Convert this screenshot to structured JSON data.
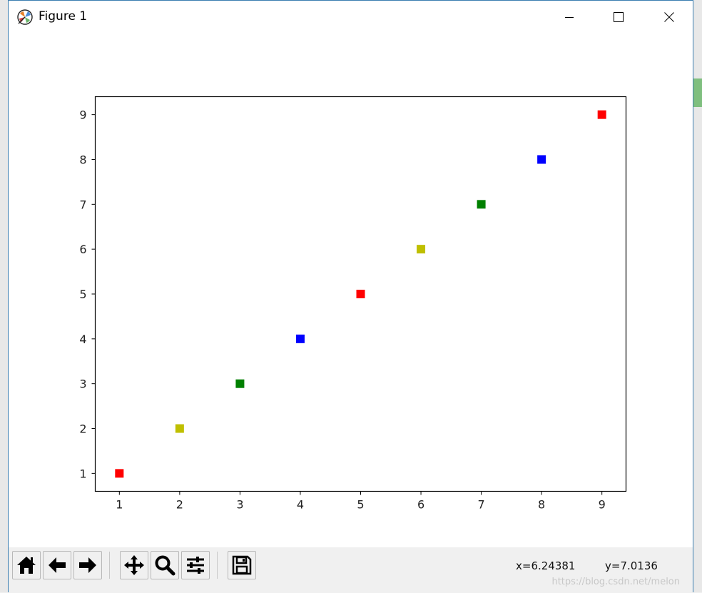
{
  "window": {
    "title": "Figure 1"
  },
  "chart_data": {
    "type": "scatter",
    "x": [
      1,
      2,
      3,
      4,
      5,
      6,
      7,
      8,
      9
    ],
    "y": [
      1,
      2,
      3,
      4,
      5,
      6,
      7,
      8,
      9
    ],
    "colors": [
      "#ff0000",
      "#bfbf00",
      "#008000",
      "#0000ff",
      "#ff0000",
      "#bfbf00",
      "#008000",
      "#0000ff",
      "#ff0000"
    ],
    "marker": "square",
    "xlim": [
      0.6,
      9.4
    ],
    "ylim": [
      0.6,
      9.4
    ],
    "xticks": [
      "1",
      "2",
      "3",
      "4",
      "5",
      "6",
      "7",
      "8",
      "9"
    ],
    "yticks": [
      "1",
      "2",
      "3",
      "4",
      "5",
      "6",
      "7",
      "8",
      "9"
    ],
    "grid": false
  },
  "toolbar": {
    "buttons": [
      "home-icon",
      "back-icon",
      "forward-icon",
      "pan-icon",
      "zoom-icon",
      "configure-subplots-icon",
      "save-icon"
    ]
  },
  "status": {
    "x_readout": "x=6.24381",
    "y_readout": "y=7.0136"
  },
  "watermark": "https://blog.csdn.net/melon"
}
